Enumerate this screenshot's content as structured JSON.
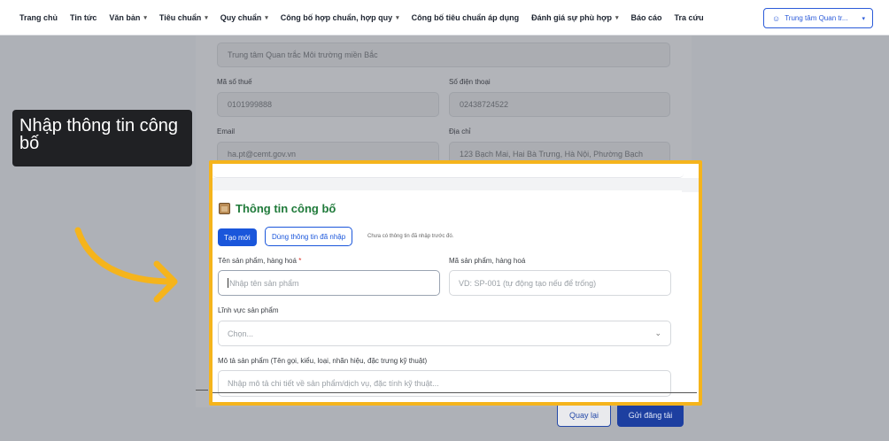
{
  "nav": {
    "items": [
      {
        "label": "Trang chủ",
        "has_caret": false
      },
      {
        "label": "Tin tức",
        "has_caret": false
      },
      {
        "label": "Văn bản",
        "has_caret": true
      },
      {
        "label": "Tiêu chuẩn",
        "has_caret": true
      },
      {
        "label": "Quy chuẩn",
        "has_caret": true
      },
      {
        "label": "Công bố hợp chuẩn, hợp quy",
        "has_caret": true
      },
      {
        "label": "Công bố tiêu chuẩn áp dụng",
        "has_caret": false
      },
      {
        "label": "Đánh giá sự phù hợp",
        "has_caret": true
      },
      {
        "label": "Báo cáo",
        "has_caret": false
      },
      {
        "label": "Tra cứu",
        "has_caret": false
      }
    ],
    "user_label": "Trung tâm Quan tr..."
  },
  "org_form": {
    "org_name_value": "Trung tâm Quan trắc Môi trường miền Bắc",
    "tax_label": "Mã số thuế",
    "tax_value": "0101999888",
    "phone_label": "Số điện thoại",
    "phone_value": "02438724522",
    "email_label": "Email",
    "email_value": "ha.pt@cemt.gov.vn",
    "address_label": "Địa chỉ",
    "address_value": "123 Bạch Mai, Hai Bà Trưng, Hà Nội, Phường Bạch"
  },
  "tooltip": {
    "text": "Nhập thông tin công bố"
  },
  "declaration": {
    "title": "Thông tin công bố",
    "btn_new": "Tạo mới",
    "btn_use_prev": "Dùng thông tin đã nhập",
    "hint": "Chưa có thông tin đã nhập trước đó.",
    "product_name_label": "Tên sản phẩm, hàng hoá",
    "product_name_required": "*",
    "product_name_placeholder": "Nhập tên sản phẩm",
    "product_code_label": "Mã sản phẩm, hàng hoá",
    "product_code_placeholder": "VD: SP-001 (tự động tạo nếu để trống)",
    "field_label": "Lĩnh vực sản phẩm",
    "field_placeholder": "Chọn...",
    "description_label": "Mô tả sản phẩm (Tên gọi, kiểu, loại, nhãn hiệu, đặc trưng kỹ thuật)",
    "description_placeholder": "Nhập mô tả chi tiết về sản phẩm/dịch vụ, đặc tính kỹ thuật..."
  },
  "footer": {
    "back": "Quay lại",
    "submit": "Gửi đăng tải"
  },
  "colors": {
    "highlight": "#f5b41c",
    "primary": "#1a56db",
    "title_green": "#1f7a3a",
    "arrow": "#f5b41c"
  }
}
